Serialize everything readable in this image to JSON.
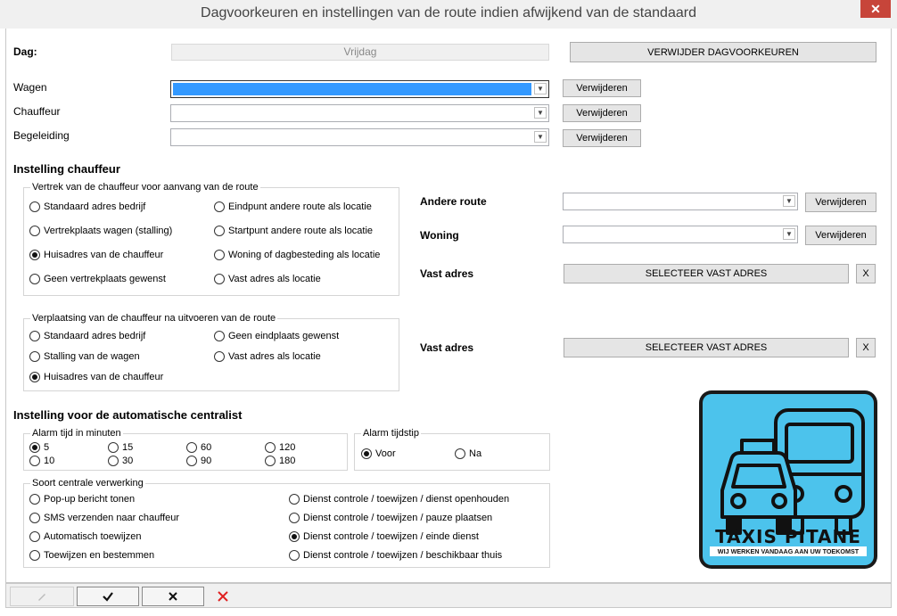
{
  "window": {
    "title": "Dagvoorkeuren en instellingen van de route indien afwijkend van de standaard",
    "close": "✕"
  },
  "day": {
    "label": "Dag:",
    "value": "Vrijdag",
    "remove_label": "VERWIJDER DAGVOORKEUREN"
  },
  "vehicle": {
    "rows": [
      {
        "label": "Wagen",
        "value": "",
        "remove": "Verwijderen"
      },
      {
        "label": "Chauffeur",
        "value": "",
        "remove": "Verwijderen"
      },
      {
        "label": "Begeleiding",
        "value": "",
        "remove": "Verwijderen"
      }
    ]
  },
  "driver_settings": {
    "title": "Instelling chauffeur",
    "departure": {
      "title": "Vertrek van de chauffeur voor aanvang van de route",
      "options": [
        {
          "label": "Standaard adres bedrijf",
          "checked": false
        },
        {
          "label": "Eindpunt andere route als locatie",
          "checked": false
        },
        {
          "label": "Vertrekplaats wagen (stalling)",
          "checked": false
        },
        {
          "label": "Startpunt andere route als locatie",
          "checked": false
        },
        {
          "label": "Huisadres van de chauffeur",
          "checked": true
        },
        {
          "label": "Woning of dagbesteding als locatie",
          "checked": false
        },
        {
          "label": "Geen vertrekplaats gewenst",
          "checked": false
        },
        {
          "label": "Vast adres als locatie",
          "checked": false
        }
      ]
    },
    "after": {
      "title": "Verplaatsing van de chauffeur na uitvoeren van de route",
      "options": [
        {
          "label": "Standaard adres bedrijf",
          "checked": false
        },
        {
          "label": "Geen eindplaats gewenst",
          "checked": false
        },
        {
          "label": "Stalling van de wagen",
          "checked": false
        },
        {
          "label": "Vast adres als locatie",
          "checked": false
        },
        {
          "label": "Huisadres van de chauffeur",
          "checked": true
        }
      ]
    },
    "other_route": {
      "label": "Andere route",
      "value": "",
      "remove": "Verwijderen"
    },
    "home": {
      "label": "Woning",
      "value": "",
      "remove": "Verwijderen"
    },
    "fixed_address_1": {
      "label": "Vast adres",
      "button": "SELECTEER VAST ADRES",
      "clear": "X"
    },
    "fixed_address_2": {
      "label": "Vast adres",
      "button": "SELECTEER VAST ADRES",
      "clear": "X"
    }
  },
  "dispatcher": {
    "title": "Instelling voor de automatische centralist",
    "alarm_minutes": {
      "title": "Alarm tijd in minuten",
      "options": [
        {
          "label": "5",
          "checked": true
        },
        {
          "label": "15",
          "checked": false
        },
        {
          "label": "60",
          "checked": false
        },
        {
          "label": "120",
          "checked": false
        },
        {
          "label": "10",
          "checked": false
        },
        {
          "label": "30",
          "checked": false
        },
        {
          "label": "90",
          "checked": false
        },
        {
          "label": "180",
          "checked": false
        }
      ]
    },
    "alarm_moment": {
      "title": "Alarm tijdstip",
      "options": [
        {
          "label": "Voor",
          "checked": true
        },
        {
          "label": "Na",
          "checked": false
        }
      ]
    },
    "processing": {
      "title": "Soort centrale verwerking",
      "options": [
        {
          "label": "Pop-up bericht tonen",
          "checked": false
        },
        {
          "label": "Dienst controle / toewijzen / dienst openhouden",
          "checked": false
        },
        {
          "label": "SMS verzenden naar chauffeur",
          "checked": false
        },
        {
          "label": "Dienst controle / toewijzen / pauze plaatsen",
          "checked": false
        },
        {
          "label": "Automatisch toewijzen",
          "checked": false
        },
        {
          "label": "Dienst controle / toewijzen / einde dienst",
          "checked": true
        },
        {
          "label": "Toewijzen en bestemmen",
          "checked": false
        },
        {
          "label": "Dienst controle / toewijzen / beschikbaar thuis",
          "checked": false
        }
      ]
    }
  },
  "logo": {
    "text_1": "TAXIS PITANE",
    "text_2": "WIJ WERKEN VANDAAG AAN UW TOEKOMST"
  },
  "toolbar": {
    "edit_icon": "pencil-icon",
    "save_icon": "check-icon",
    "close_icon": "x-icon",
    "delete_icon": "red-x-icon"
  },
  "colors": {
    "selected": "#3399ff",
    "logo_bg": "#4cc3ec",
    "delete": "#e02020"
  }
}
